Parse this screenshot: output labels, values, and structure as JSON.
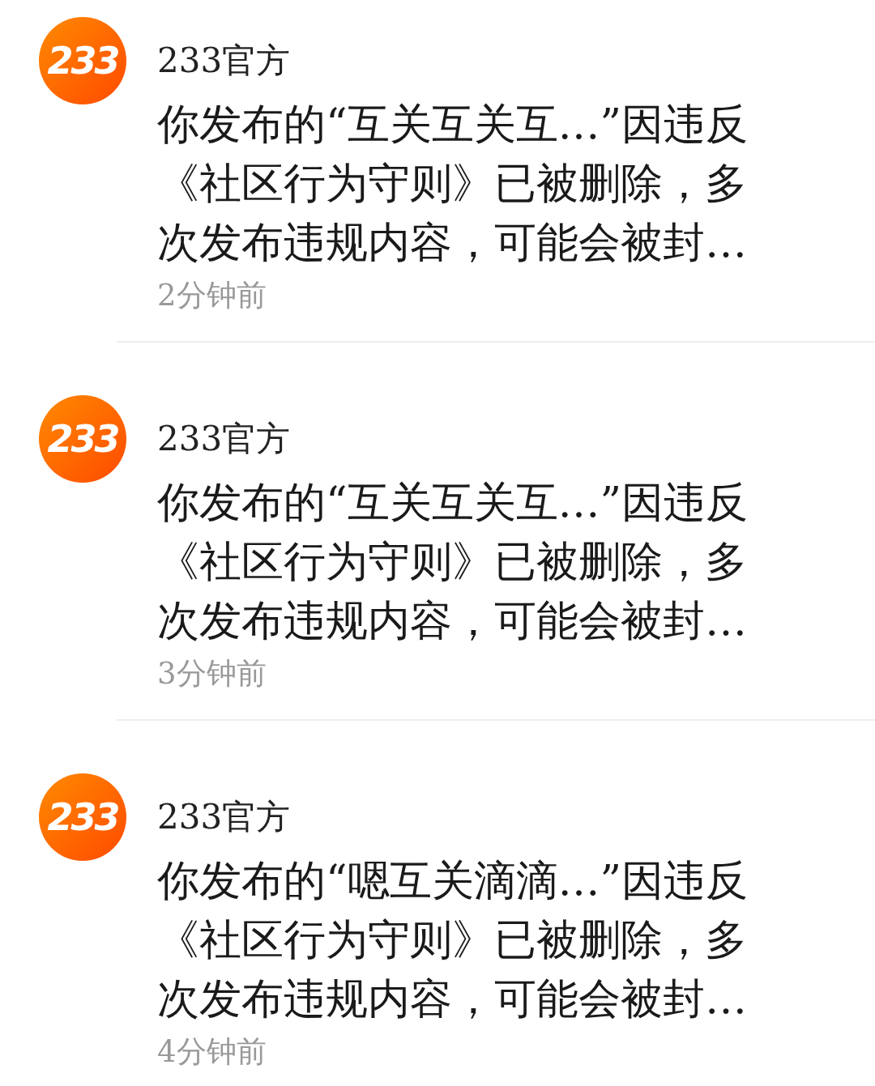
{
  "messages": [
    {
      "avatar_text": "233",
      "sender": "233官方",
      "text": "你发布的“互关互关互…”因违反《社区行为守则》已被删除，多次发布违规内容，可能会被封…",
      "time": "2分钟前"
    },
    {
      "avatar_text": "233",
      "sender": "233官方",
      "text": "你发布的“互关互关互…”因违反《社区行为守则》已被删除，多次发布违规内容，可能会被封…",
      "time": "3分钟前"
    },
    {
      "avatar_text": "233",
      "sender": "233官方",
      "text": "你发布的“嗯互关滴滴…”因违反《社区行为守则》已被删除，多次发布违规内容，可能会被封…",
      "time": "4分钟前"
    }
  ]
}
